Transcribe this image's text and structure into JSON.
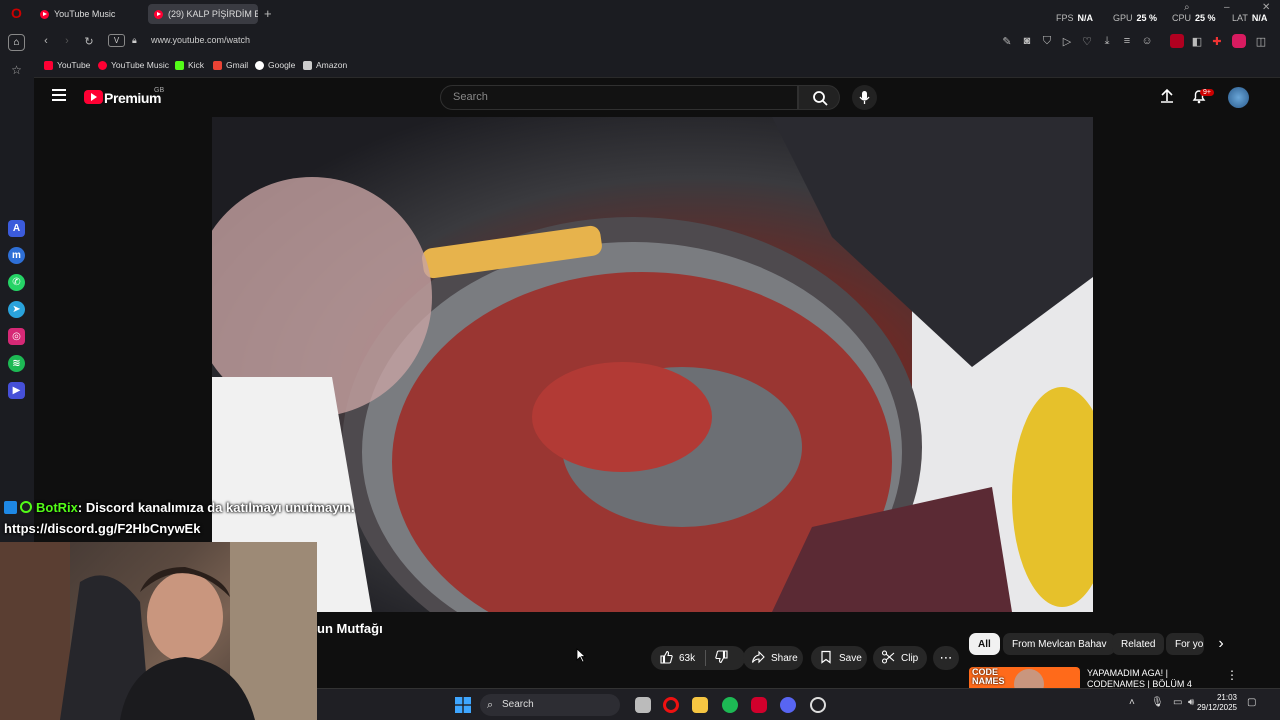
{
  "browser": {
    "tabs": [
      {
        "label": "YouTube Music",
        "active": false
      },
      {
        "label": "(29) KALP PİŞİRDİM E",
        "active": true
      }
    ],
    "stats": {
      "fps_label": "FPS",
      "fps_value": "N/A",
      "gpu_label": "GPU",
      "gpu_value": "25 %",
      "cpu_label": "CPU",
      "cpu_value": "25 %",
      "lat_label": "LAT",
      "lat_value": "N/A"
    },
    "url_badge": "V",
    "url": "www.youtube.com/watch",
    "bookmarks": [
      {
        "label": "YouTube",
        "color": "#ff0033"
      },
      {
        "label": "YouTube Music",
        "color": "#ff0033"
      },
      {
        "label": "Kick",
        "color": "#53fc18"
      },
      {
        "label": "Gmail",
        "color": "#ea4335"
      },
      {
        "label": "Google",
        "color": "#4285f4"
      },
      {
        "label": "Amazon",
        "color": "#cccccc"
      }
    ]
  },
  "youtube": {
    "logo_text": "Premium",
    "region": "GB",
    "search_placeholder": "Search",
    "notifications_badge": "9+",
    "channel_fragment": "un Mutfağı",
    "like_count": "63k",
    "actions": {
      "share": "Share",
      "save": "Save",
      "clip": "Clip"
    },
    "chips": [
      "All",
      "From Mevlcan Bahav",
      "Related",
      "For yo"
    ],
    "recommendation": {
      "thumb_text": "CODE NAMES",
      "title": "YAPAMADIM AGA! | CODENAMES | BÖLÜM 4"
    }
  },
  "chat": {
    "username": "BotRix",
    "message": ": Discord kanalımıza da katılmayı unutmayın.",
    "link": "https://discord.gg/F2HbCnywEk"
  },
  "taskbar": {
    "search_label": "Search",
    "time": "21:03",
    "date": "29/12/2025"
  }
}
